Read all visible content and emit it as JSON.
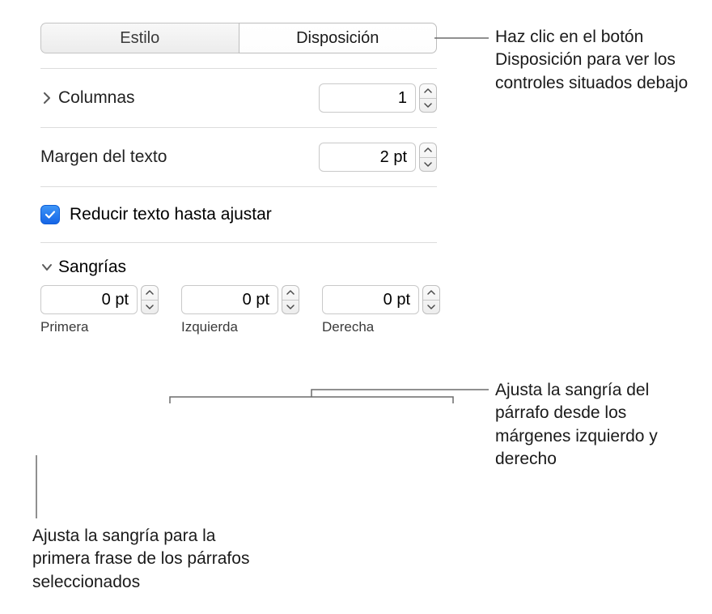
{
  "tabs": {
    "style": "Estilo",
    "layout": "Disposición"
  },
  "columns": {
    "label": "Columnas",
    "value": "1"
  },
  "textMargin": {
    "label": "Margen del texto",
    "value": "2 pt"
  },
  "shrinkText": {
    "label": "Reducir texto hasta ajustar",
    "checked": true
  },
  "indents": {
    "header": "Sangrías",
    "first": {
      "value": "0 pt",
      "caption": "Primera"
    },
    "left": {
      "value": "0 pt",
      "caption": "Izquierda"
    },
    "right": {
      "value": "0 pt",
      "caption": "Derecha"
    }
  },
  "callouts": {
    "layoutBtn": "Haz clic en el botón Disposición para ver los controles situados debajo",
    "leftRight": "Ajusta la sangría del párrafo desde los márgenes izquierdo y derecho",
    "first": "Ajusta la sangría para la primera frase de los párrafos seleccionados"
  }
}
